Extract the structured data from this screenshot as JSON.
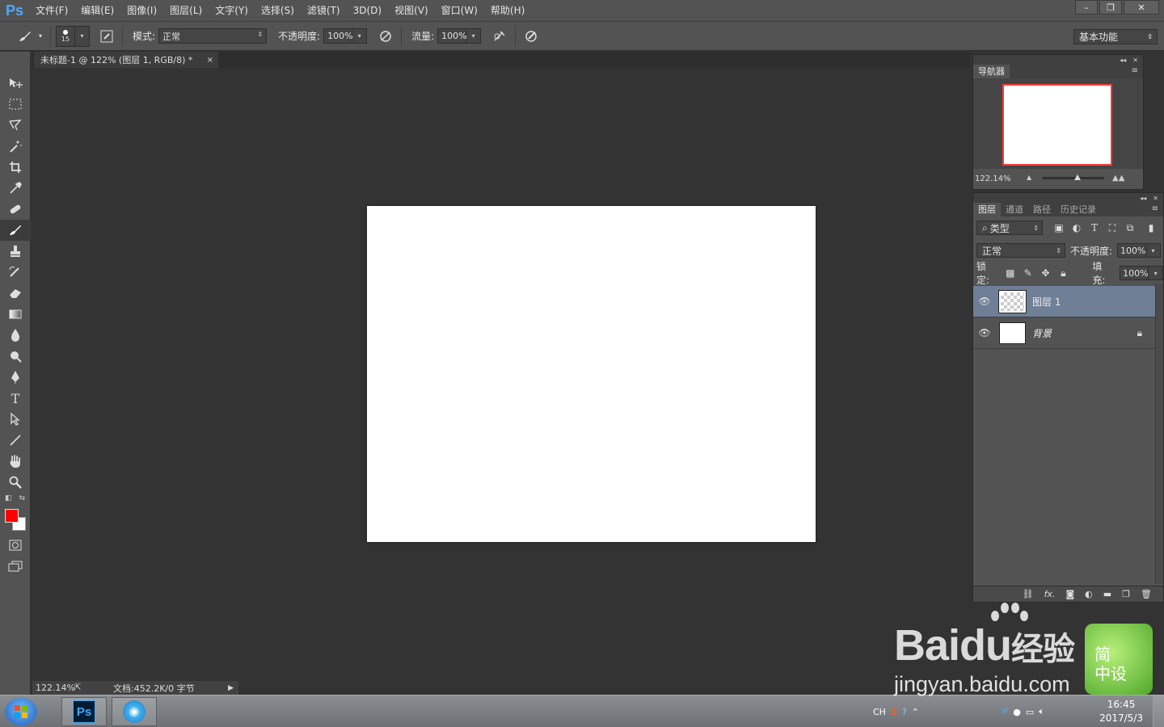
{
  "app": {
    "logo": "Ps"
  },
  "menu": [
    "文件(F)",
    "编辑(E)",
    "图像(I)",
    "图层(L)",
    "文字(Y)",
    "选择(S)",
    "滤镜(T)",
    "3D(D)",
    "视图(V)",
    "窗口(W)",
    "帮助(H)"
  ],
  "window_controls": {
    "minimize": "–",
    "restore": "❐",
    "close": "✕"
  },
  "options": {
    "brush_size": "15",
    "mode_label": "模式:",
    "mode_value": "正常",
    "opacity_label": "不透明度:",
    "opacity_value": "100%",
    "flow_label": "流量:",
    "flow_value": "100%",
    "workspace": "基本功能"
  },
  "tools": [
    "move-tool",
    "marquee-tool",
    "lasso-tool",
    "magic-wand-tool",
    "crop-tool",
    "eyedropper-tool",
    "healing-brush-tool",
    "brush-tool",
    "clone-stamp-tool",
    "history-brush-tool",
    "eraser-tool",
    "gradient-tool",
    "blur-tool",
    "dodge-tool",
    "pen-tool",
    "type-tool",
    "path-selection-tool",
    "line-tool",
    "hand-tool",
    "zoom-tool"
  ],
  "colors": {
    "foreground": "#ff0000",
    "background": "#ffffff"
  },
  "document": {
    "tab_title": "未标题-1 @ 122% (图层 1, RGB/8) *",
    "close": "×"
  },
  "status": {
    "zoom": "122.14%",
    "doc_info": "文档:452.2K/0 字节"
  },
  "navigator": {
    "tab": "导航器",
    "zoom": "122.14%"
  },
  "layers_panel": {
    "tabs": [
      "图层",
      "通道",
      "路径",
      "历史记录"
    ],
    "filter_label": "类型",
    "blend_mode": "正常",
    "opacity_label": "不透明度:",
    "opacity_value": "100%",
    "lock_label": "锁定:",
    "fill_label": "填充:",
    "fill_value": "100%",
    "layers": [
      {
        "name": "图层 1",
        "selected": true
      },
      {
        "name": "背景",
        "selected": false,
        "locked": true
      }
    ],
    "footer_fx": "fx."
  },
  "taskbar": {
    "ps_label": "Ps",
    "tray_lang": "CH",
    "time": "16:45",
    "date": "2017/5/3"
  },
  "watermark": {
    "brand": "Bai",
    "brand2": "du",
    "brand3": "经验",
    "url": "jingyan.baidu.com",
    "badge": "简\n中设"
  }
}
